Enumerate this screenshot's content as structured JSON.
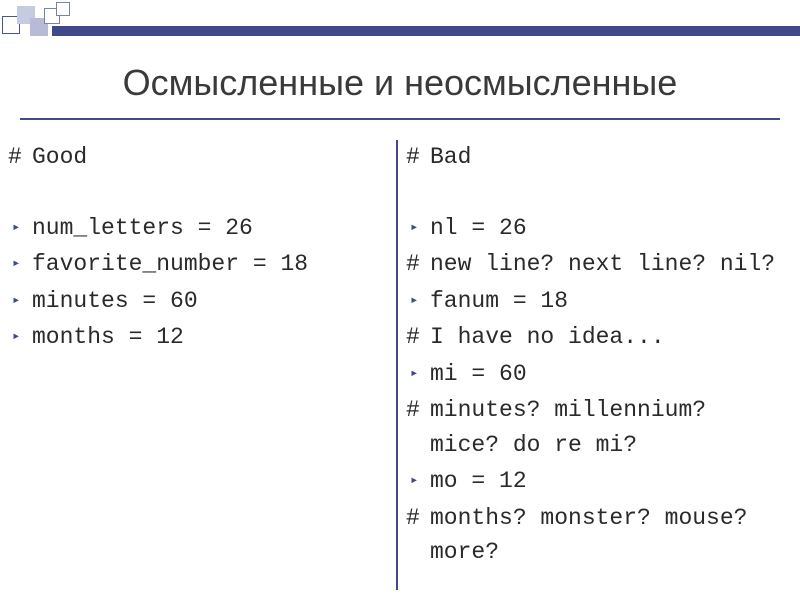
{
  "title": "Осмысленные и неосмысленные",
  "left": {
    "header": "Good",
    "items": [
      "num_letters = 26",
      "favorite_number = 18",
      "minutes = 60",
      "months = 12"
    ]
  },
  "right": {
    "header": "Bad",
    "lines": [
      {
        "kind": "code",
        "text": "nl = 26"
      },
      {
        "kind": "comment",
        "text": "new line? next line? nil?"
      },
      {
        "kind": "code",
        "text": "fanum = 18"
      },
      {
        "kind": "comment",
        "text": "I have no idea..."
      },
      {
        "kind": "code",
        "text": "mi = 60"
      },
      {
        "kind": "comment",
        "text": "minutes? millennium? mice? do re mi?"
      },
      {
        "kind": "code",
        "text": "mo = 12"
      },
      {
        "kind": "comment",
        "text": "months? monster? mouse? more?"
      }
    ]
  }
}
